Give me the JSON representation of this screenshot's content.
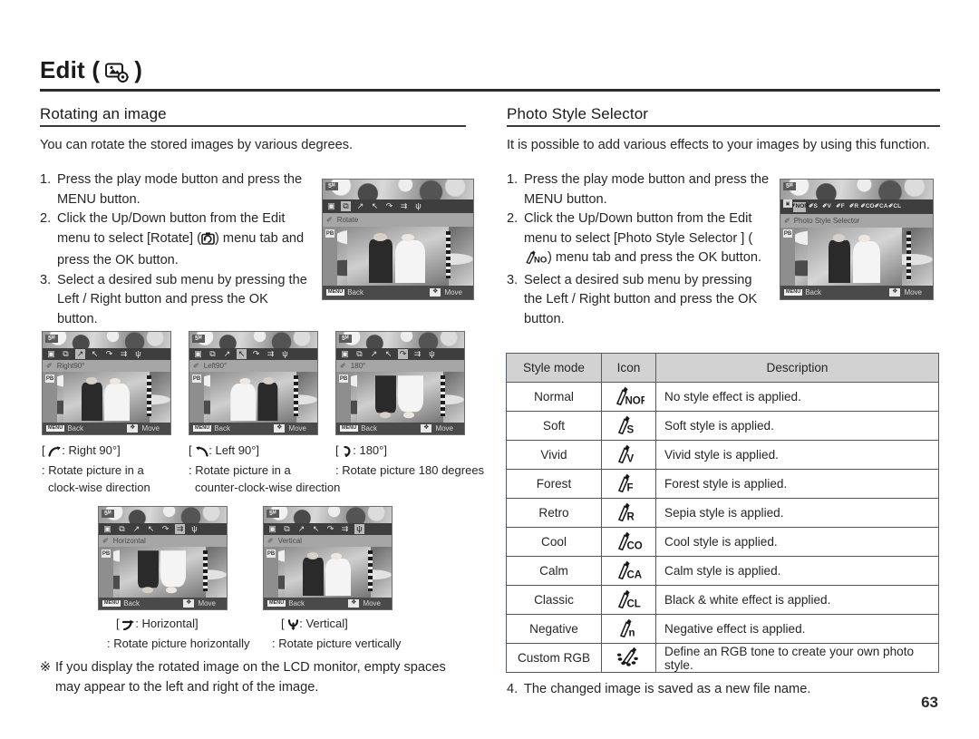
{
  "chapter": {
    "title": "Edit (",
    "title_close": ")",
    "icon": "edit-photo-gear-icon"
  },
  "left_column": {
    "heading": "Rotating an image",
    "intro": "You can rotate the stored images by various degrees.",
    "steps": [
      {
        "num": "1.",
        "text": "Press the play mode button and press the MENU button."
      },
      {
        "num": "2.",
        "text_a": "Click the Up/Down button from the Edit menu to select [Rotate] (",
        "icon": "rotate-icon",
        "text_b": ") menu tab and press the OK button."
      },
      {
        "num": "3.",
        "text": "Select a desired sub menu by pressing the Left / Right button and press the OK button."
      }
    ],
    "note_mark": "※",
    "note": "If you display the rotated image on the LCD monitor, empty spaces may appear to the left and right of the image."
  },
  "right_column": {
    "heading": "Photo Style Selector",
    "intro": "It is possible to add various effects to your images by using this function.",
    "steps": [
      {
        "num": "1.",
        "text": "Press the play mode button and press the MENU button."
      },
      {
        "num": "2.",
        "text_a": "Click the Up/Down button from the Edit menu to select [Photo Style Selector ] (",
        "icon": "photo-style-nor-icon",
        "text_b": ") menu tab and press the OK button."
      },
      {
        "num": "3.",
        "text": "Select a desired sub menu by pressing the Left / Right button and press the OK button."
      }
    ],
    "final_step": {
      "num": "4.",
      "text": "The changed image is saved as a new file name."
    }
  },
  "lcd_rotate_main": {
    "size_badge": "5ᴹ",
    "label": "Rotate",
    "menu_icons": [
      "resize-icon",
      "rotate-icon",
      "right90-icon",
      "left90-icon",
      "180-icon",
      "horizontal-icon",
      "vertical-icon"
    ],
    "selected_index": 1,
    "side_button": "PB",
    "back": "Back",
    "move": "Move",
    "menu_key": "MENU"
  },
  "lcd_style_main": {
    "size_badge": "5ᴹ",
    "label": "Photo Style Selector",
    "menu_icons": [
      "NOR",
      "S",
      "V",
      "F",
      "R",
      "CO",
      "CA",
      "CL"
    ],
    "selected_index": 0,
    "side_button": "PB",
    "back": "Back",
    "move": "Move",
    "menu_key": "MENU"
  },
  "rotate_thumbs": [
    {
      "name": "right-90",
      "size_badge": "5ᴹ",
      "label": "Right90°",
      "selected_index": 2,
      "back": "Back",
      "move": "Move",
      "menu_key": "MENU",
      "caption_symbol": "right90-icon",
      "caption_title": ":  Right 90°]",
      "caption_open": "[",
      "caption_lines": [
        ": Rotate picture in a",
        "clock-wise direction"
      ]
    },
    {
      "name": "left-90",
      "size_badge": "5ᴹ",
      "label": "Left90°",
      "selected_index": 3,
      "back": "Back",
      "move": "Move",
      "menu_key": "MENU",
      "caption_symbol": "left90-icon",
      "caption_title": ":  Left 90°]",
      "caption_open": "[",
      "caption_lines": [
        ": Rotate picture in a",
        "counter-clock-wise direction"
      ]
    },
    {
      "name": "180",
      "size_badge": "5ᴹ",
      "label": "180°",
      "selected_index": 4,
      "back": "Back",
      "move": "Move",
      "menu_key": "MENU",
      "caption_symbol": "180-icon",
      "caption_title": ":  180°]",
      "caption_open": "[",
      "caption_lines": [
        ": Rotate picture 180 degrees"
      ]
    },
    {
      "name": "horizontal",
      "size_badge": "5ᴹ",
      "label": "Horizontal",
      "selected_index": 5,
      "back": "Back",
      "move": "Move",
      "menu_key": "MENU",
      "caption_symbol": "horizontal-icon",
      "caption_title": ":  Horizontal]",
      "caption_open": "[",
      "caption_lines": [
        ": Rotate picture horizontally"
      ]
    },
    {
      "name": "vertical",
      "size_badge": "5ᴹ",
      "label": "Vertical",
      "selected_index": 6,
      "back": "Back",
      "move": "Move",
      "menu_key": "MENU",
      "caption_symbol": "vertical-icon",
      "caption_title": ":  Vertical]",
      "caption_open": "[",
      "caption_lines": [
        ": Rotate picture vertically"
      ]
    }
  ],
  "style_table": {
    "headers": [
      "Style mode",
      "Icon",
      "Description"
    ],
    "rows": [
      {
        "mode": "Normal",
        "icon": "NOR",
        "desc": "No style effect is applied."
      },
      {
        "mode": "Soft",
        "icon": "S",
        "desc": "Soft style is applied."
      },
      {
        "mode": "Vivid",
        "icon": "V",
        "desc": "Vivid style is applied."
      },
      {
        "mode": "Forest",
        "icon": "F",
        "desc": "Forest style is applied."
      },
      {
        "mode": "Retro",
        "icon": "R",
        "desc": "Sepia style is applied."
      },
      {
        "mode": "Cool",
        "icon": "CO",
        "desc": "Cool style is applied."
      },
      {
        "mode": "Calm",
        "icon": "CA",
        "desc": "Calm style is applied."
      },
      {
        "mode": "Classic",
        "icon": "CL",
        "desc": "Black & white effect is applied."
      },
      {
        "mode": "Negative",
        "icon": "n",
        "desc": "Negative effect is applied."
      },
      {
        "mode": "Custom RGB",
        "icon": "rgb",
        "desc": "Define an RGB tone to create your own photo style."
      }
    ]
  },
  "page_number": "63",
  "colors": {
    "text": "#262626",
    "rule": "#2b2b2b",
    "table_header_bg": "#d2d2d2",
    "table_border": "#555a66"
  }
}
